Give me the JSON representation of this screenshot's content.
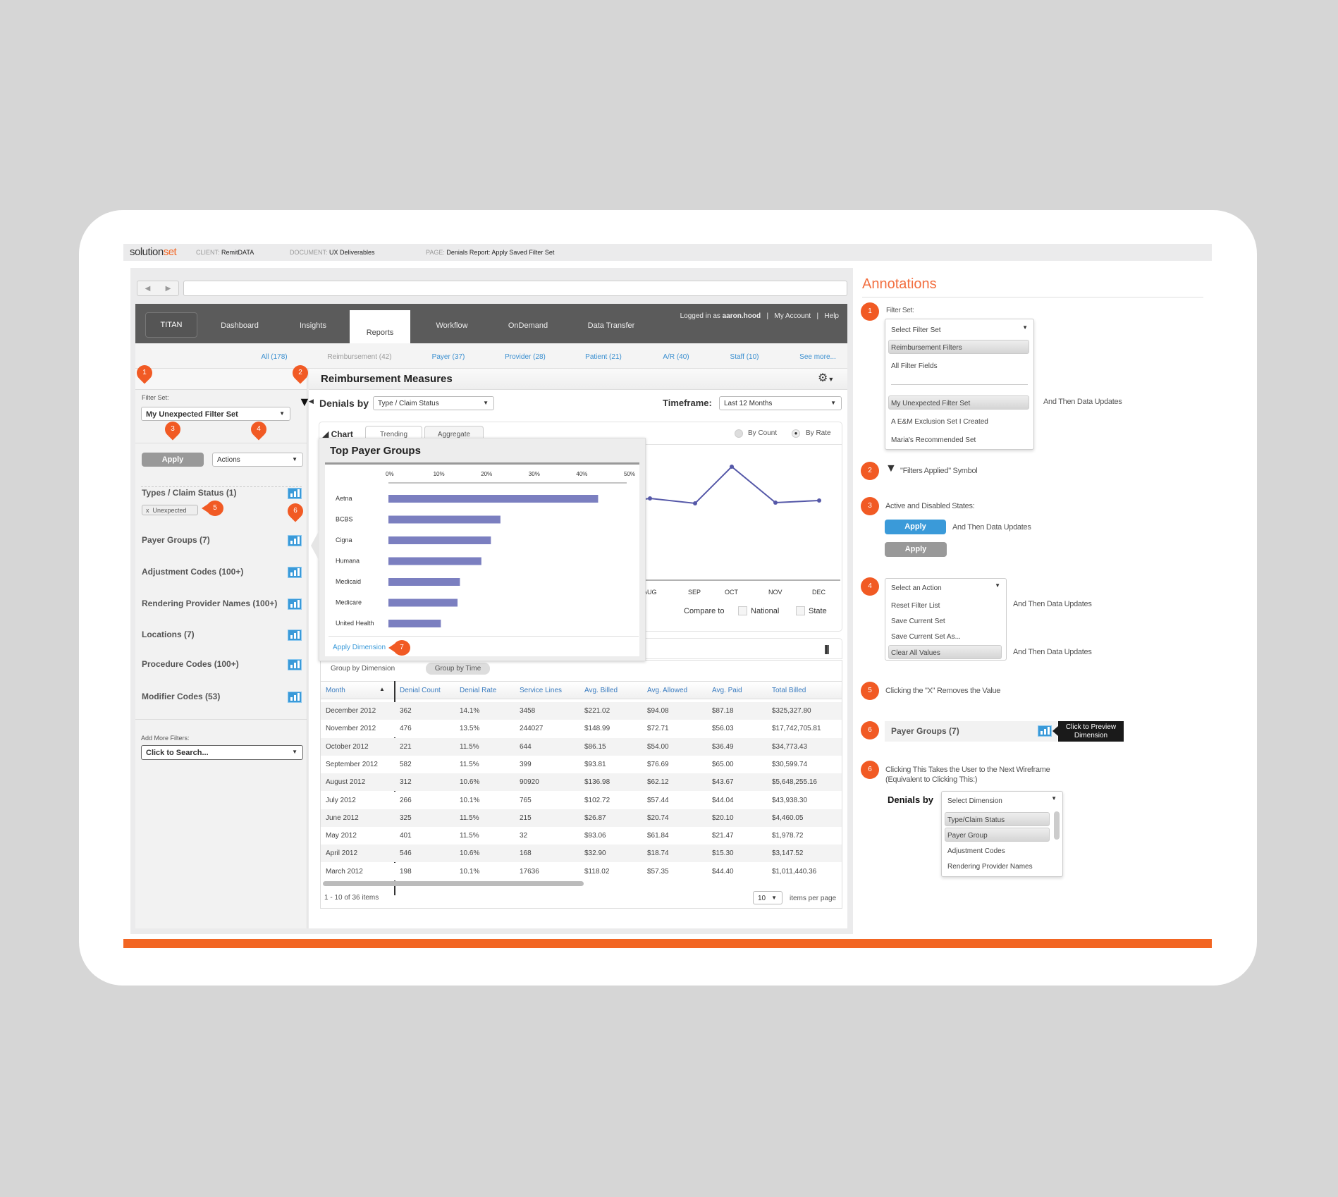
{
  "header": {
    "logo": "solutionset",
    "client_label": "CLIENT:",
    "client": "RemitDATA",
    "document_label": "DOCUMENT:",
    "document": "UX Deliverables",
    "page_label": "PAGE:",
    "page": "Denials Report: Apply Saved Filter Set"
  },
  "nav": {
    "brand": "TITAN",
    "items": [
      "Dashboard",
      "Insights",
      "Reports",
      "Workflow",
      "OnDemand",
      "Data Transfer"
    ],
    "active": "Reports",
    "logged_in_prefix": "Logged in as",
    "user": "aaron.hood",
    "my_account": "My Account",
    "help": "Help",
    "sep": "|"
  },
  "subnav": [
    "All (178)",
    "Reimbursement (42)",
    "Payer (37)",
    "Provider (28)",
    "Patient (21)",
    "A/R (40)",
    "Staff (10)",
    "See more..."
  ],
  "sidebar": {
    "filter_set_label": "Filter Set:",
    "filter_set_value": "My Unexpected Filter Set",
    "apply": "Apply",
    "actions": "Actions",
    "filters": [
      "Types / Claim Status (1)",
      "Payer Groups (7)",
      "Adjustment Codes (100+)",
      "Rendering Provider Names (100+)",
      "Locations (7)",
      "Procedure Codes (100+)",
      "Modifier Codes (53)"
    ],
    "chip": "Unexpected",
    "chip_x": "x",
    "add_more_label": "Add More Filters:",
    "search_placeholder": "Click to Search..."
  },
  "main": {
    "title": "Reimbursement Measures",
    "denials_by": "Denials by",
    "dimension": "Type / Claim Status",
    "timeframe_label": "Timeframe:",
    "timeframe": "Last 12 Months",
    "tabs": [
      "Chart",
      "Trending",
      "Aggregate"
    ],
    "by_count": "By Count",
    "by_rate": "By Rate",
    "selected_mode": "By Rate",
    "months": [
      "AUG",
      "SEP",
      "OCT",
      "NOV",
      "DEC"
    ],
    "compare_to": "Compare to",
    "national": "National",
    "state": "State",
    "group_by_dimension": "Group by Dimension",
    "group_by_time": "Group by Time"
  },
  "popup": {
    "title": "Top Payer Groups",
    "apply_dimension": "Apply Dimension",
    "bar_color": "#7b7fc0"
  },
  "chart_data": {
    "type": "bar",
    "orientation": "horizontal",
    "title": "Top Payer Groups",
    "categories": [
      "Aetna",
      "BCBS",
      "Cigna",
      "Humana",
      "Medicaid",
      "Medicare",
      "United Health"
    ],
    "values": [
      44,
      23.5,
      21.5,
      19.5,
      15,
      14.5,
      11
    ],
    "xticks": [
      "0%",
      "10%",
      "20%",
      "30%",
      "40%",
      "50%"
    ],
    "xlim": [
      0,
      50
    ]
  },
  "table": {
    "columns": [
      "Month",
      "Denial Count",
      "Denial Rate",
      "Service Lines",
      "Avg. Billed",
      "Avg. Allowed",
      "Avg. Paid",
      "Total Billed"
    ],
    "rows": [
      [
        "December 2012",
        "362",
        "14.1%",
        "3458",
        "$221.02",
        "$94.08",
        "$87.18",
        "$325,327.80"
      ],
      [
        "November 2012",
        "476",
        "13.5%",
        "244027",
        "$148.99",
        "$72.71",
        "$56.03",
        "$17,742,705.81"
      ],
      [
        "October 2012",
        "221",
        "11.5%",
        "644",
        "$86.15",
        "$54.00",
        "$36.49",
        "$34,773.43"
      ],
      [
        "September 2012",
        "582",
        "11.5%",
        "399",
        "$93.81",
        "$76.69",
        "$65.00",
        "$30,599.74"
      ],
      [
        "August 2012",
        "312",
        "10.6%",
        "90920",
        "$136.98",
        "$62.12",
        "$43.67",
        "$5,648,255.16"
      ],
      [
        "July 2012",
        "266",
        "10.1%",
        "765",
        "$102.72",
        "$57.44",
        "$44.04",
        "$43,938.30"
      ],
      [
        "June 2012",
        "325",
        "11.5%",
        "215",
        "$26.87",
        "$20.74",
        "$20.10",
        "$4,460.05"
      ],
      [
        "May 2012",
        "401",
        "11.5%",
        "32",
        "$93.06",
        "$61.84",
        "$21.47",
        "$1,978.72"
      ],
      [
        "April 2012",
        "546",
        "10.6%",
        "168",
        "$32.90",
        "$18.74",
        "$15.30",
        "$3,147.52"
      ],
      [
        "March 2012",
        "198",
        "10.1%",
        "17636",
        "$118.02",
        "$57.35",
        "$44.40",
        "$1,011,440.36"
      ]
    ],
    "pager": "1 - 10 of 36 items",
    "per_page": "10",
    "per_page_label": "items per page"
  },
  "annotations": {
    "title": "Annotations",
    "a1": {
      "num": "1",
      "label": "Filter Set:",
      "select": "Select Filter Set",
      "options": [
        "Reimbursement Filters",
        "All Filter Fields",
        "My Unexpected Filter Set",
        "A E&M Exclusion Set I Created",
        "Maria's Recommended Set"
      ],
      "note": "And Then Data Updates"
    },
    "a2": {
      "num": "2",
      "text": "\"Filters Applied\" Symbol"
    },
    "a3": {
      "num": "3",
      "text": "Active and Disabled States:",
      "apply": "Apply",
      "note": "And Then Data Updates"
    },
    "a4": {
      "num": "4",
      "select": "Select an Action",
      "options": [
        "Reset Filter List",
        "Save Current Set",
        "Save Current Set As...",
        "Clear All Values"
      ],
      "note1": "And Then Data Updates",
      "note2": "And Then Data Updates"
    },
    "a5": {
      "num": "5",
      "text": "Clicking the \"X\" Removes the Value"
    },
    "a6": {
      "num": "6",
      "label": "Payer Groups (7)",
      "tooltip": "Click to Preview Dimension"
    },
    "a7": {
      "num": "6",
      "line1": "Clicking This Takes the User to the Next Wireframe",
      "line2": "(Equivalent to Clicking This:)",
      "denials_by": "Denials by",
      "select": "Select Dimension",
      "options": [
        "Type/Claim Status",
        "Payer Group",
        "Adjustment Codes",
        "Rendering Provider Names"
      ]
    },
    "pins": [
      "1",
      "2",
      "3",
      "4",
      "5",
      "6",
      "7"
    ],
    "accent": "#f15a24",
    "apply_active": "#3a9ad9",
    "apply_disabled": "#999999"
  }
}
